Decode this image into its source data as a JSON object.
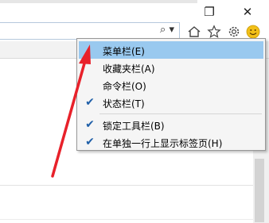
{
  "window": {
    "restore_glyph": "❐",
    "close_glyph": "✕"
  },
  "toolbar": {
    "search_glyph": "⌕ ▾",
    "icons": [
      "home-icon",
      "favorites-star-icon",
      "settings-gear-icon",
      "feedback-smiley-icon"
    ]
  },
  "context_menu": {
    "items": [
      {
        "label": "菜单栏(E)",
        "checked": false,
        "highlighted": true
      },
      {
        "label": "收藏夹栏(A)",
        "checked": false,
        "highlighted": false
      },
      {
        "label": "命令栏(O)",
        "checked": false,
        "highlighted": false
      },
      {
        "label": "状态栏(T)",
        "checked": true,
        "highlighted": false
      },
      {
        "label": "锁定工具栏(B)",
        "checked": true,
        "highlighted": false
      },
      {
        "label": "在单独一行上显示标签页(H)",
        "checked": true,
        "highlighted": false
      }
    ],
    "check_glyph": "✔"
  },
  "colors": {
    "highlight": "#99c9ef",
    "annotation_arrow": "#e8212a",
    "smiley": "#f2c018"
  }
}
